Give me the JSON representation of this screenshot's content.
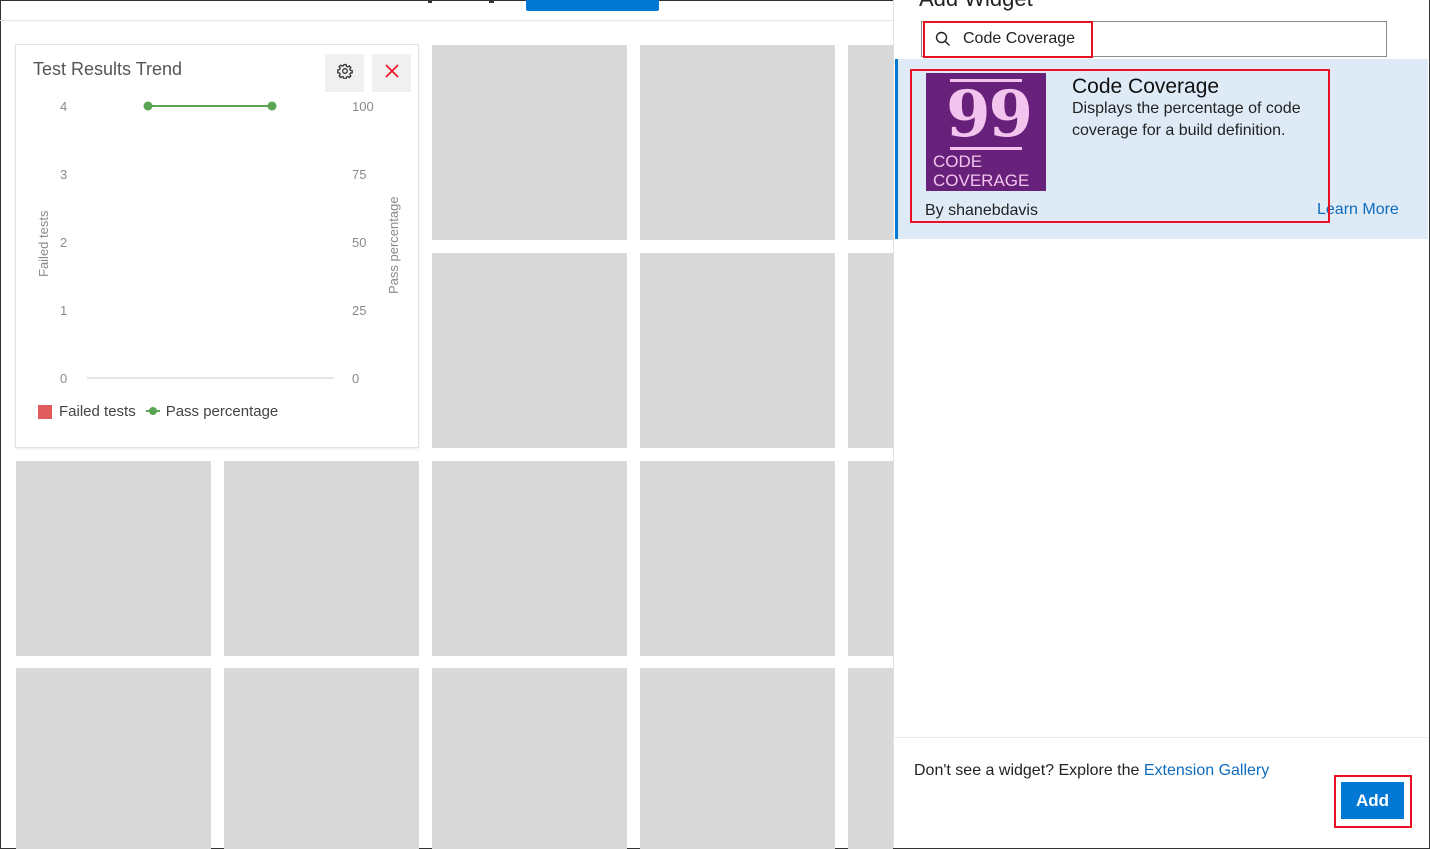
{
  "dashboard": {
    "widget": {
      "title": "Test Results Trend",
      "left_axis_label": "Failed tests",
      "right_axis_label": "Pass percentage",
      "left_ticks": [
        "4",
        "3",
        "2",
        "1",
        "0"
      ],
      "right_ticks": [
        "100",
        "75",
        "50",
        "25",
        "0"
      ],
      "legend": [
        "Failed tests",
        "Pass percentage"
      ],
      "settings_icon": "gear-icon",
      "close_icon": "close-icon",
      "colors": {
        "failed": "#e05b5b",
        "pass": "#5aa454",
        "close": "#e81123"
      }
    }
  },
  "chart_data": {
    "type": "line",
    "title": "Test Results Trend",
    "ylabel": "Failed tests",
    "y2label": "Pass percentage",
    "ylim": [
      0,
      4
    ],
    "y2lim": [
      0,
      100
    ],
    "series": [
      {
        "name": "Pass percentage",
        "axis": "right",
        "values": [
          100,
          100
        ]
      },
      {
        "name": "Failed tests",
        "axis": "left",
        "values": [
          0,
          0
        ]
      }
    ],
    "legend": "bottom-left",
    "grid": false
  },
  "panel": {
    "title": "Add Widget",
    "search": {
      "value": "Code Coverage",
      "icon": "search-icon"
    },
    "result": {
      "name": "Code Coverage",
      "description": "Displays the percentage of code coverage for a build definition.",
      "author": "By shanebdavis",
      "learn_more": "Learn More",
      "logo": {
        "number": "99",
        "line1": "CODE",
        "line2": "COVERAGE",
        "bg": "#68217a",
        "fg": "#f2c4ee"
      }
    },
    "footer": {
      "text": "Don't see a widget? Explore the ",
      "link": "Extension Gallery",
      "add_label": "Add"
    },
    "accent": "#0078d4",
    "highlight": "#e81123"
  }
}
